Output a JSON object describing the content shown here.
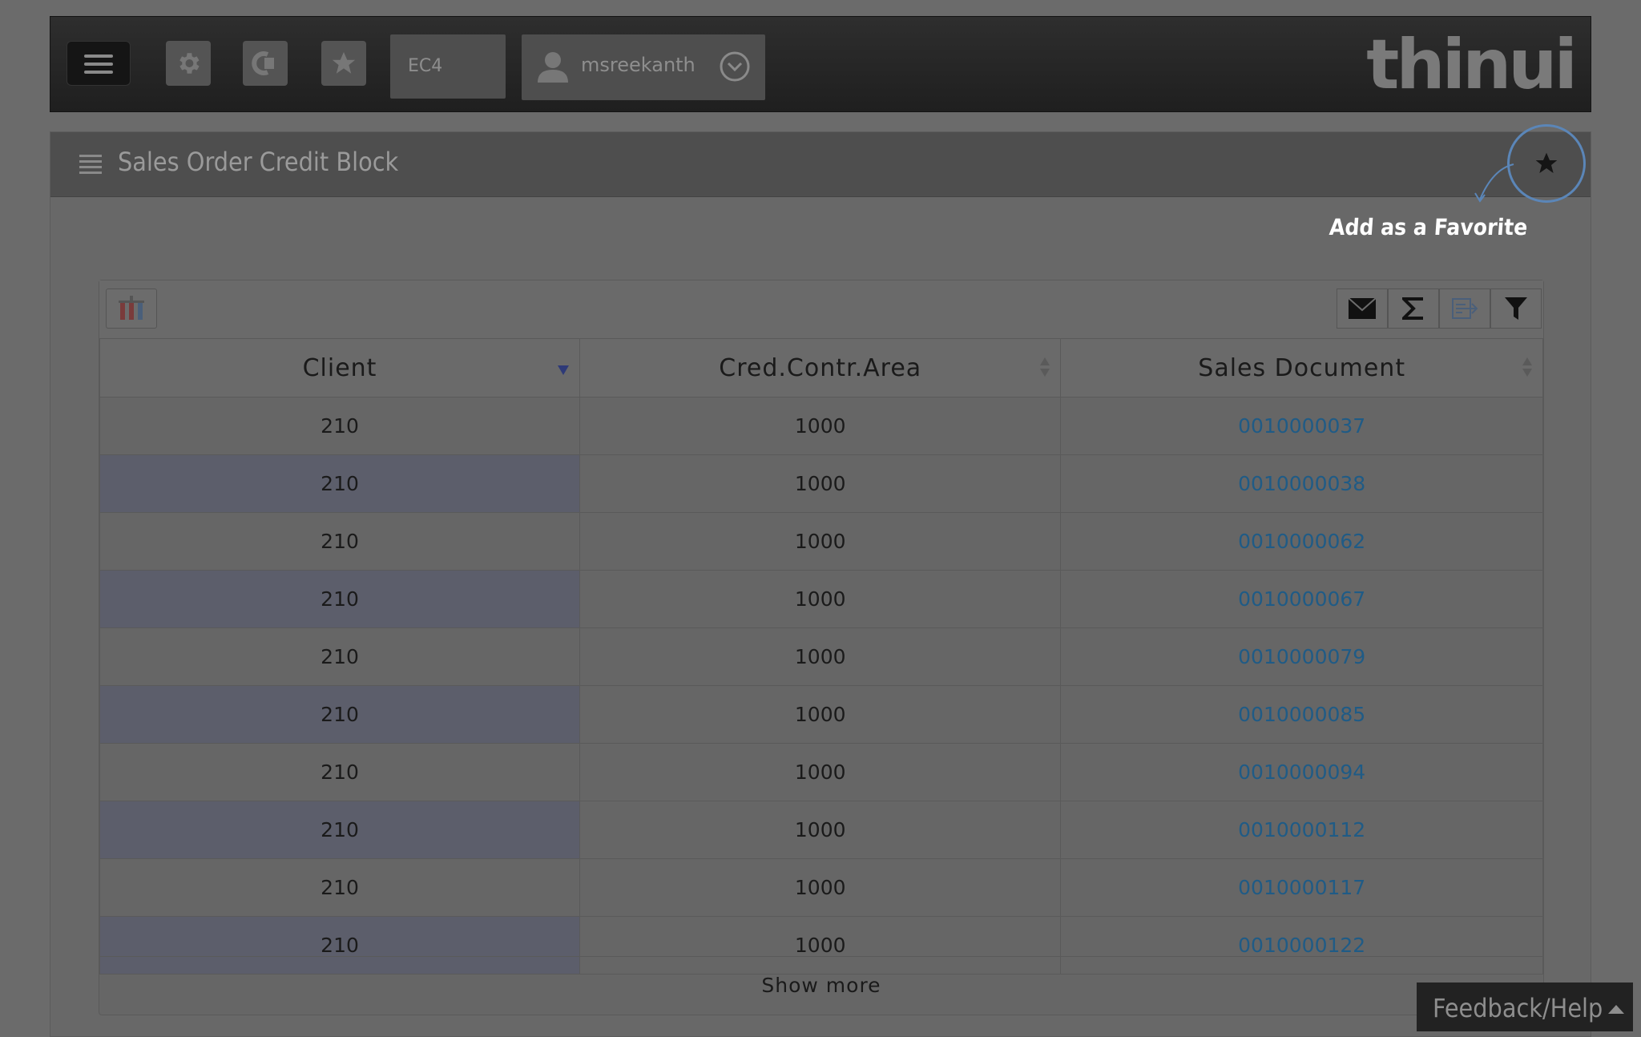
{
  "header": {
    "system": "EC4",
    "username": "msreekanth",
    "logo_text": "thinui"
  },
  "page": {
    "title": "Sales Order Credit Block",
    "favorite_hint": "Add as a Favorite"
  },
  "table": {
    "columns": [
      "Client",
      "Cred.Contr.Area",
      "Sales Document"
    ],
    "rows": [
      {
        "client": "210",
        "area": "1000",
        "doc": "0010000037"
      },
      {
        "client": "210",
        "area": "1000",
        "doc": "0010000038"
      },
      {
        "client": "210",
        "area": "1000",
        "doc": "0010000062"
      },
      {
        "client": "210",
        "area": "1000",
        "doc": "0010000067"
      },
      {
        "client": "210",
        "area": "1000",
        "doc": "0010000079"
      },
      {
        "client": "210",
        "area": "1000",
        "doc": "0010000085"
      },
      {
        "client": "210",
        "area": "1000",
        "doc": "0010000094"
      },
      {
        "client": "210",
        "area": "1000",
        "doc": "0010000112"
      },
      {
        "client": "210",
        "area": "1000",
        "doc": "0010000117"
      },
      {
        "client": "210",
        "area": "1000",
        "doc": "0010000122"
      }
    ],
    "show_more": "Show more"
  },
  "footer": {
    "feedback": "Feedback/Help"
  },
  "colors": {
    "link": "#1f5b86",
    "highlight_circle": "#5b86b8"
  }
}
